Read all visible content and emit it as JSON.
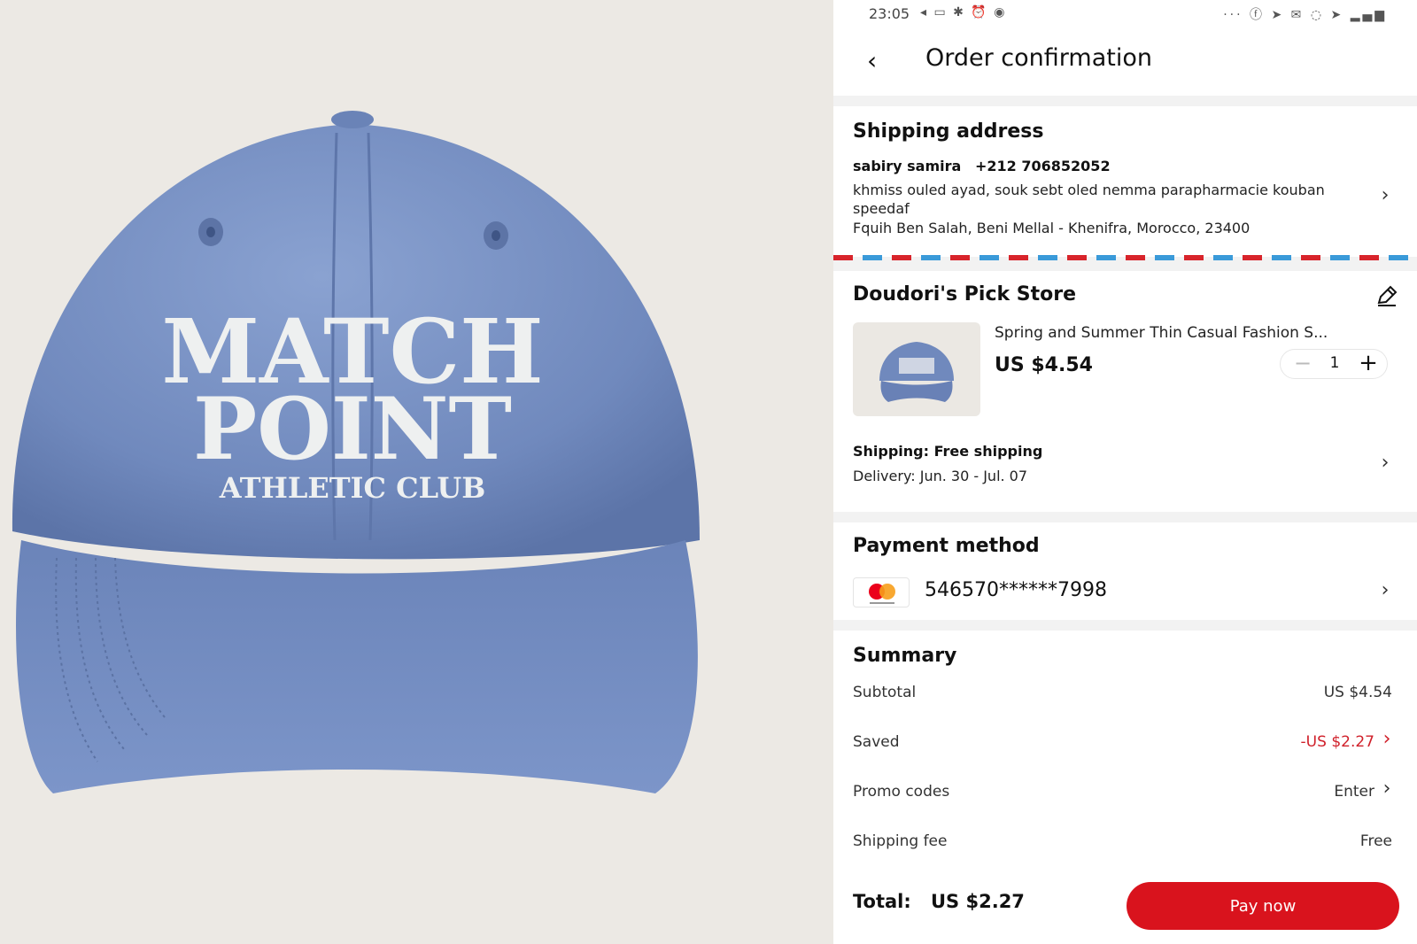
{
  "product_photo": {
    "cap_text_line1": "MATCH",
    "cap_text_line2": "POINT",
    "cap_text_line3": "ATHLETIC CLUB",
    "cap_color": "#7a93c4"
  },
  "status_bar": {
    "time": "23:05",
    "left_icons": "◂ ▭ ✱ ⏰ ◉",
    "right_icons": "··· ⓕ ➤ ✉ ◌ ➤ ▂▄▆"
  },
  "header": {
    "back_icon": "‹",
    "title": "Order confirmation"
  },
  "shipping_address": {
    "title": "Shipping address",
    "name": "sabiry samira",
    "phone": "+212 706852052",
    "line1": "khmiss ouled ayad, souk sebt oled nemma parapharmacie kouban speedaf",
    "line2": "Fquih Ben Salah, Beni Mellal - Khenifra, Morocco, 23400"
  },
  "store": {
    "name": "Doudori's Pick Store",
    "product_title": "Spring and Summer Thin Casual Fashion S...",
    "price": "US $4.54",
    "quantity": "1",
    "minus": "−",
    "plus": "+",
    "shipping": "Shipping: Free shipping",
    "delivery": "Delivery: Jun. 30 - Jul. 07"
  },
  "payment": {
    "title": "Payment method",
    "card_number": "546570******7998"
  },
  "summary": {
    "title": "Summary",
    "subtotal_label": "Subtotal",
    "subtotal_value": "US $4.54",
    "saved_label": "Saved",
    "saved_value": "-US $2.27",
    "promo_label": "Promo codes",
    "promo_value": "Enter",
    "shipping_fee_label": "Shipping fee",
    "shipping_fee_value": "Free",
    "total_label": "Total:",
    "total_value": "US $2.27",
    "pay_button": "Pay now"
  },
  "colors": {
    "accent_red": "#d9131d",
    "saved_red": "#d0202a",
    "airmail_red": "#d8242b",
    "airmail_blue": "#3a9ad9"
  },
  "chevron": "›"
}
